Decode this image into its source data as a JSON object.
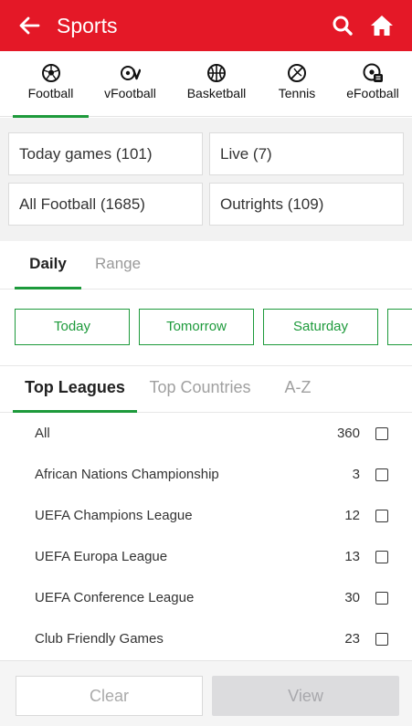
{
  "header": {
    "title": "Sports",
    "icons": [
      "back-arrow-icon",
      "search-icon",
      "home-icon"
    ]
  },
  "sport_tabs": [
    {
      "label": "Football",
      "icon": "football-icon",
      "active": true
    },
    {
      "label": "vFootball",
      "icon": "vfootball-icon",
      "active": false
    },
    {
      "label": "Basketball",
      "icon": "basketball-icon",
      "active": false
    },
    {
      "label": "Tennis",
      "icon": "tennis-icon",
      "active": false
    },
    {
      "label": "eFootball",
      "icon": "efootball-icon",
      "active": false
    }
  ],
  "quick_filters": {
    "today": "Today games (101)",
    "live": "Live (7)",
    "all": "All Football (1685)",
    "outrights": "Outrights (109)"
  },
  "period_tabs": {
    "daily": "Daily",
    "range": "Range",
    "active": "Daily"
  },
  "days": [
    "Today",
    "Tomorrow",
    "Saturday",
    ""
  ],
  "league_tabs": {
    "top_leagues": "Top Leagues",
    "top_countries": "Top Countries",
    "az": "A-Z",
    "active": "Top Leagues"
  },
  "leagues": [
    {
      "name": "All",
      "count": "360",
      "checked": false
    },
    {
      "name": "African Nations Championship",
      "count": "3",
      "checked": false
    },
    {
      "name": "UEFA Champions League",
      "count": "12",
      "checked": false
    },
    {
      "name": "UEFA Europa League",
      "count": "13",
      "checked": false
    },
    {
      "name": "UEFA Conference League",
      "count": "30",
      "checked": false
    },
    {
      "name": "Club Friendly Games",
      "count": "23",
      "checked": false
    }
  ],
  "footer": {
    "clear": "Clear",
    "view": "View"
  },
  "colors": {
    "brand_red": "#e41827",
    "accent_green": "#1d9a3b",
    "disabled_gray": "#dcdcde"
  }
}
